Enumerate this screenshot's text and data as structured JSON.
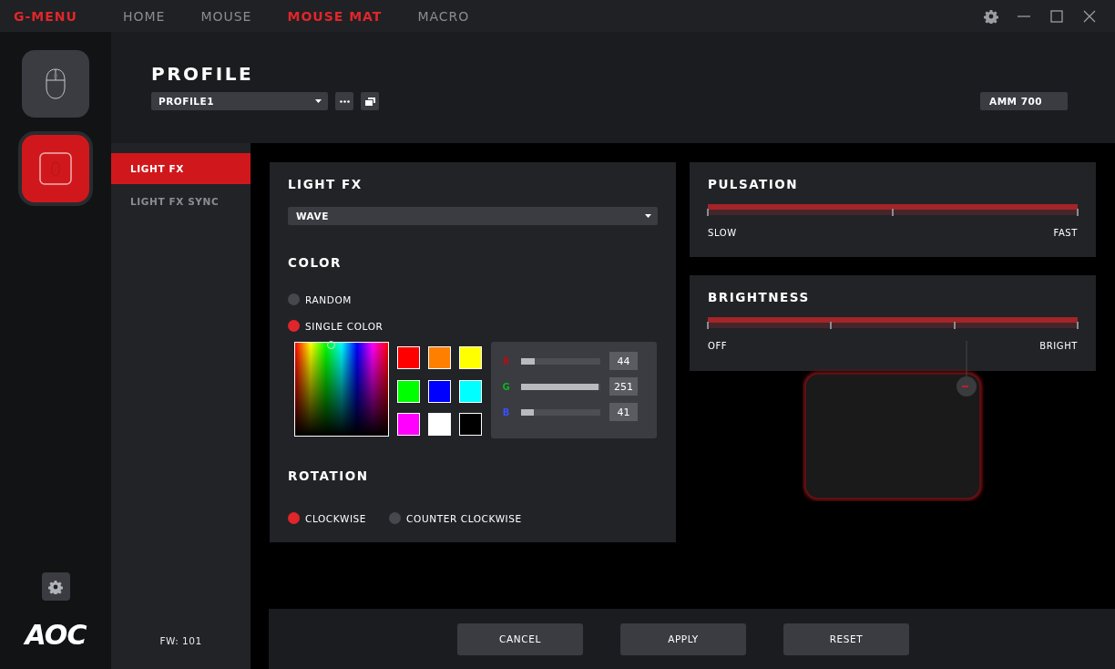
{
  "app_title": "G-MENU",
  "nav_tabs": [
    {
      "label": "HOME",
      "selected": false
    },
    {
      "label": "MOUSE",
      "selected": false
    },
    {
      "label": "MOUSE MAT",
      "selected": true
    },
    {
      "label": "MACRO",
      "selected": false
    }
  ],
  "devices": [
    {
      "kind": "mouse",
      "selected": false
    },
    {
      "kind": "mousemat",
      "selected": true
    }
  ],
  "logo": "AOC",
  "profile": {
    "title": "PROFILE",
    "dropdown": "PROFILE1",
    "model": "AMM 700"
  },
  "submenu": [
    {
      "label": "LIGHT FX",
      "selected": true
    },
    {
      "label": "LIGHT FX SYNC",
      "selected": false
    }
  ],
  "firmware": "FW: 101",
  "light_fx": {
    "title": "LIGHT FX",
    "effect": "WAVE"
  },
  "color": {
    "title": "COLOR",
    "modes": [
      {
        "label": "RANDOM",
        "selected": false
      },
      {
        "label": "SINGLE COLOR",
        "selected": true
      }
    ],
    "swatches": [
      {
        "color": "#ff0000"
      },
      {
        "color": "#ff8000"
      },
      {
        "color": "#ffff00"
      },
      {
        "color": "#00ff00"
      },
      {
        "color": "#0000ff"
      },
      {
        "color": "#00ffff"
      },
      {
        "color": "#ff00ff"
      },
      {
        "color": "#ffffff"
      },
      {
        "color": "#000000"
      }
    ],
    "channels": [
      {
        "name": "R",
        "color": "#b01018",
        "level": 0.17,
        "value": "44"
      },
      {
        "name": "G",
        "color": "#10b020",
        "level": 0.98,
        "value": "251"
      },
      {
        "name": "B",
        "color": "#3a50ff",
        "level": 0.16,
        "value": "41"
      }
    ]
  },
  "rotation": {
    "title": "ROTATION",
    "options": [
      {
        "label": "CLOCKWISE",
        "selected": true
      },
      {
        "label": "COUNTER CLOCKWISE",
        "selected": false
      }
    ]
  },
  "pulsation": {
    "title": "PULSATION",
    "level": 1,
    "min_label": "SLOW",
    "max_label": "FAST"
  },
  "brightness": {
    "title": "BRIGHTNESS",
    "level": 1,
    "min_label": "OFF",
    "max_label": "BRIGHT"
  },
  "buttons": [
    "CANCEL",
    "APPLY",
    "RESET"
  ]
}
